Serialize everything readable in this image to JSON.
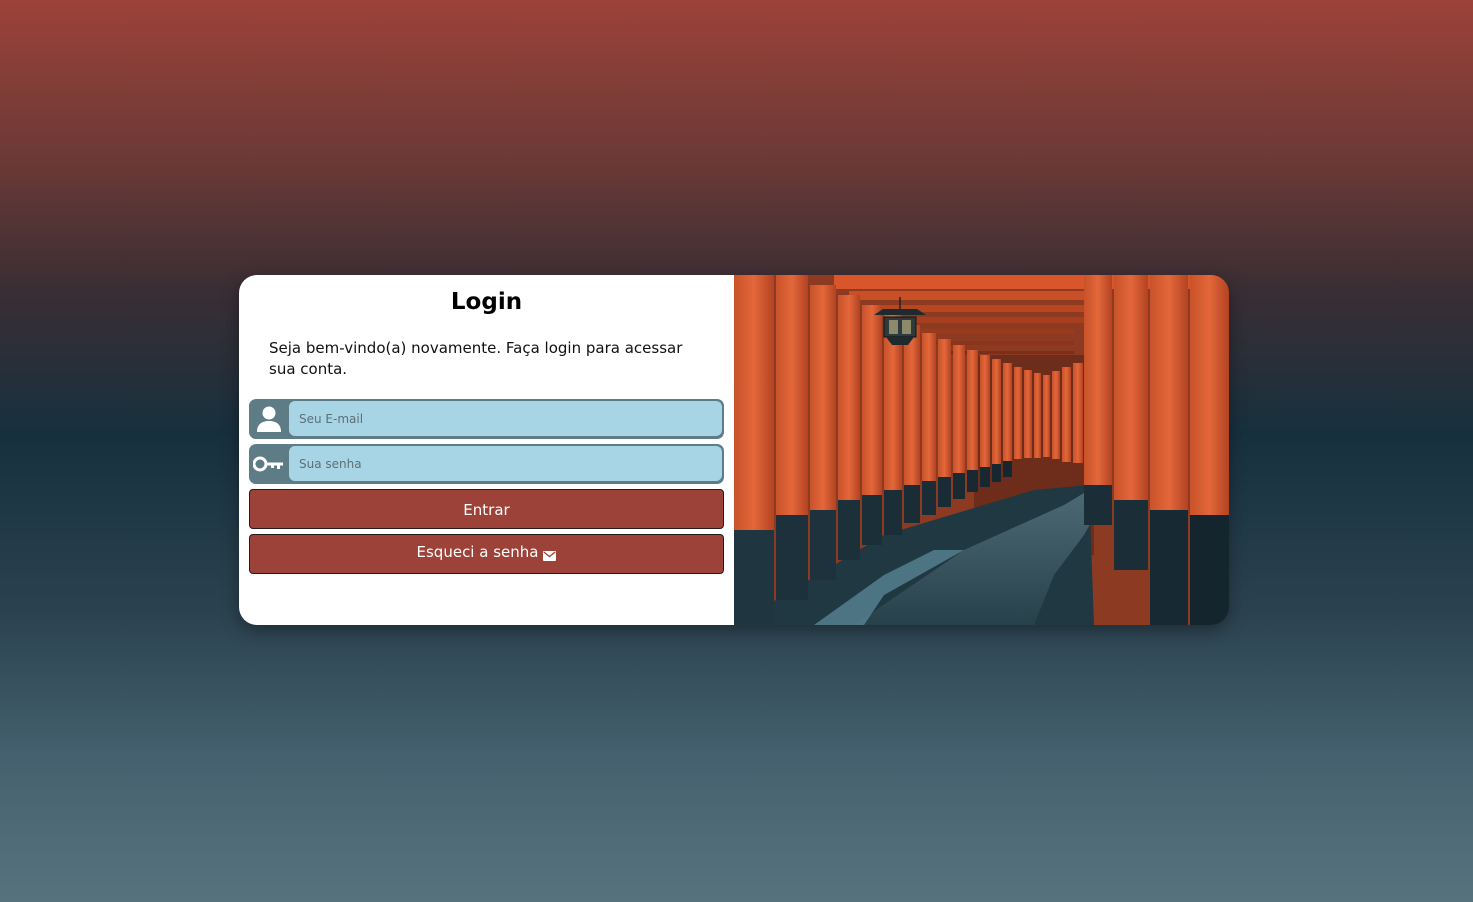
{
  "login": {
    "title": "Login",
    "subtitle": "Seja bem-vindo(a) novamente. Faça login para acessar sua conta.",
    "email_placeholder": "Seu E-mail",
    "password_placeholder": "Sua senha",
    "enter_label": "Entrar",
    "forgot_label": "Esqueci a senha"
  },
  "icons": {
    "email_field": "user-icon",
    "password_field": "key-icon",
    "forgot_button": "mail-icon"
  },
  "colors": {
    "accent": "#9c4239",
    "field_bg": "#a8d5e5",
    "field_icon_bg": "#5e7c86"
  }
}
